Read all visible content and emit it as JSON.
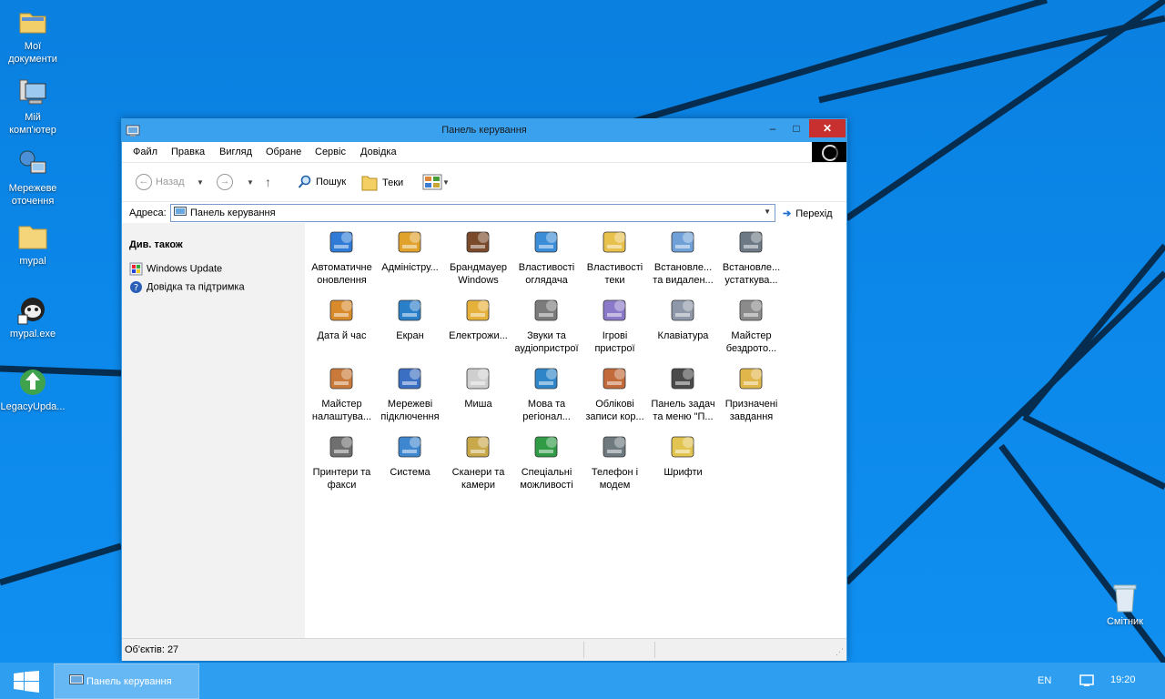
{
  "desktop": {
    "icons": [
      {
        "label": "Мої документи",
        "icon": "folder-documents-icon"
      },
      {
        "label": "Мій комп'ютер",
        "icon": "computer-icon"
      },
      {
        "label": "Мережеве оточення",
        "icon": "network-icon"
      },
      {
        "label": "mypal",
        "icon": "folder-icon"
      },
      {
        "label": "mypal.exe",
        "icon": "mypal-app-icon"
      },
      {
        "label": "LegacyUpda...",
        "icon": "update-icon"
      }
    ],
    "recycle_bin": "Смітник"
  },
  "window": {
    "title": "Панель керування",
    "controls": {
      "minimize": "–",
      "maximize": "□",
      "close": "✕"
    },
    "menu": [
      "Файл",
      "Правка",
      "Вигляд",
      "Обране",
      "Сервіс",
      "Довідка"
    ],
    "toolbar": {
      "back": "Назад",
      "search": "Пошук",
      "folders": "Теки"
    },
    "address": {
      "label": "Адреса:",
      "value": "Панель керування",
      "go": "Перехід"
    },
    "left_pane": {
      "heading": "Див. також",
      "links": [
        "Windows Update",
        "Довідка та підтримка"
      ]
    },
    "items": [
      {
        "l1": "Автоматичне",
        "l2": "оновлення",
        "icon": "auto-update-icon"
      },
      {
        "l1": "Адміністру...",
        "l2": "",
        "icon": "admin-tools-icon"
      },
      {
        "l1": "Брандмауер",
        "l2": "Windows",
        "icon": "firewall-icon"
      },
      {
        "l1": "Властивості",
        "l2": "оглядача",
        "icon": "internet-options-icon"
      },
      {
        "l1": "Властивості",
        "l2": "теки",
        "icon": "folder-options-icon"
      },
      {
        "l1": "Встановле...",
        "l2": "та видален...",
        "icon": "add-remove-programs-icon"
      },
      {
        "l1": "Встановле...",
        "l2": "устаткува...",
        "icon": "add-hardware-icon"
      },
      {
        "l1": "Дата й час",
        "l2": "",
        "icon": "date-time-icon"
      },
      {
        "l1": "Екран",
        "l2": "",
        "icon": "display-icon"
      },
      {
        "l1": "Електрожи...",
        "l2": "",
        "icon": "power-options-icon"
      },
      {
        "l1": "Звуки та",
        "l2": "аудіопристрої",
        "icon": "sound-icon"
      },
      {
        "l1": "Ігрові",
        "l2": "пристрої",
        "icon": "game-controller-icon"
      },
      {
        "l1": "Клавіатура",
        "l2": "",
        "icon": "keyboard-icon"
      },
      {
        "l1": "Майстер",
        "l2": "бездрото...",
        "icon": "wireless-wizard-icon"
      },
      {
        "l1": "Майстер",
        "l2": "налаштува...",
        "icon": "network-setup-icon"
      },
      {
        "l1": "Мережеві",
        "l2": "підключення",
        "icon": "network-connections-icon"
      },
      {
        "l1": "Миша",
        "l2": "",
        "icon": "mouse-icon"
      },
      {
        "l1": "Мова та",
        "l2": "регіонал...",
        "icon": "regional-icon"
      },
      {
        "l1": "Облікові",
        "l2": "записи кор...",
        "icon": "user-accounts-icon"
      },
      {
        "l1": "Панель задач",
        "l2": "та меню \"П...",
        "icon": "taskbar-icon"
      },
      {
        "l1": "Призначені",
        "l2": "завдання",
        "icon": "scheduled-tasks-icon"
      },
      {
        "l1": "Принтери та",
        "l2": "факси",
        "icon": "printer-icon"
      },
      {
        "l1": "Система",
        "l2": "",
        "icon": "system-icon"
      },
      {
        "l1": "Сканери та",
        "l2": "камери",
        "icon": "scanner-icon"
      },
      {
        "l1": "Спеціальні",
        "l2": "можливості",
        "icon": "accessibility-icon"
      },
      {
        "l1": "Телефон і",
        "l2": "модем",
        "icon": "phone-modem-icon"
      },
      {
        "l1": "Шрифти",
        "l2": "",
        "icon": "fonts-folder-icon"
      }
    ],
    "status": "Об'єктів: 27"
  },
  "taskbar": {
    "task_label": "Панель керування",
    "lang": "EN",
    "clock": "19:20"
  },
  "colors": {
    "accent": "#2e9ef0",
    "close": "#c7302f"
  }
}
